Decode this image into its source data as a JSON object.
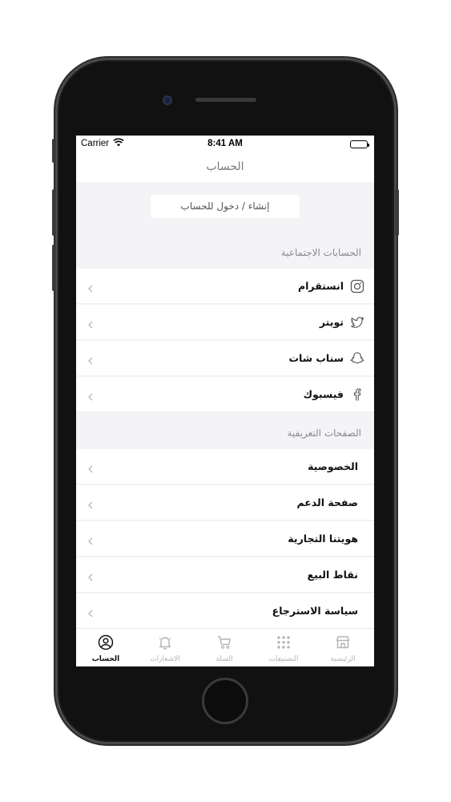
{
  "status_bar": {
    "carrier": "Carrier",
    "time": "8:41 AM"
  },
  "nav": {
    "title": "الحساب"
  },
  "login": {
    "label": "إنشاء / دخول للحساب"
  },
  "social": {
    "header": "الحسابات الاجتماعية",
    "items": [
      {
        "label": "انستقرام",
        "icon": "instagram-icon"
      },
      {
        "label": "تويتر",
        "icon": "twitter-icon"
      },
      {
        "label": "سناب شات",
        "icon": "snapchat-icon"
      },
      {
        "label": "فيسبوك",
        "icon": "facebook-icon"
      }
    ]
  },
  "pages": {
    "header": "الصفحات التعريفية",
    "items": [
      {
        "label": "الخصوصية"
      },
      {
        "label": "صفحة الدعم"
      },
      {
        "label": "هويتنا التجارية"
      },
      {
        "label": "نقاط البيع"
      },
      {
        "label": "سياسة الاسترجاع"
      }
    ]
  },
  "tabs": [
    {
      "label": "الحساب",
      "icon": "user-icon",
      "active": true
    },
    {
      "label": "الاشعارات",
      "icon": "bell-icon",
      "active": false
    },
    {
      "label": "السلة",
      "icon": "cart-icon",
      "active": false
    },
    {
      "label": "التصنيفات",
      "icon": "grid-icon",
      "active": false
    },
    {
      "label": "الرئيسية",
      "icon": "store-icon",
      "active": false
    }
  ],
  "colors": {
    "accent": "#111111",
    "inactive": "#b3b3b8",
    "background": "#f4f4f6",
    "row": "#ffffff"
  }
}
